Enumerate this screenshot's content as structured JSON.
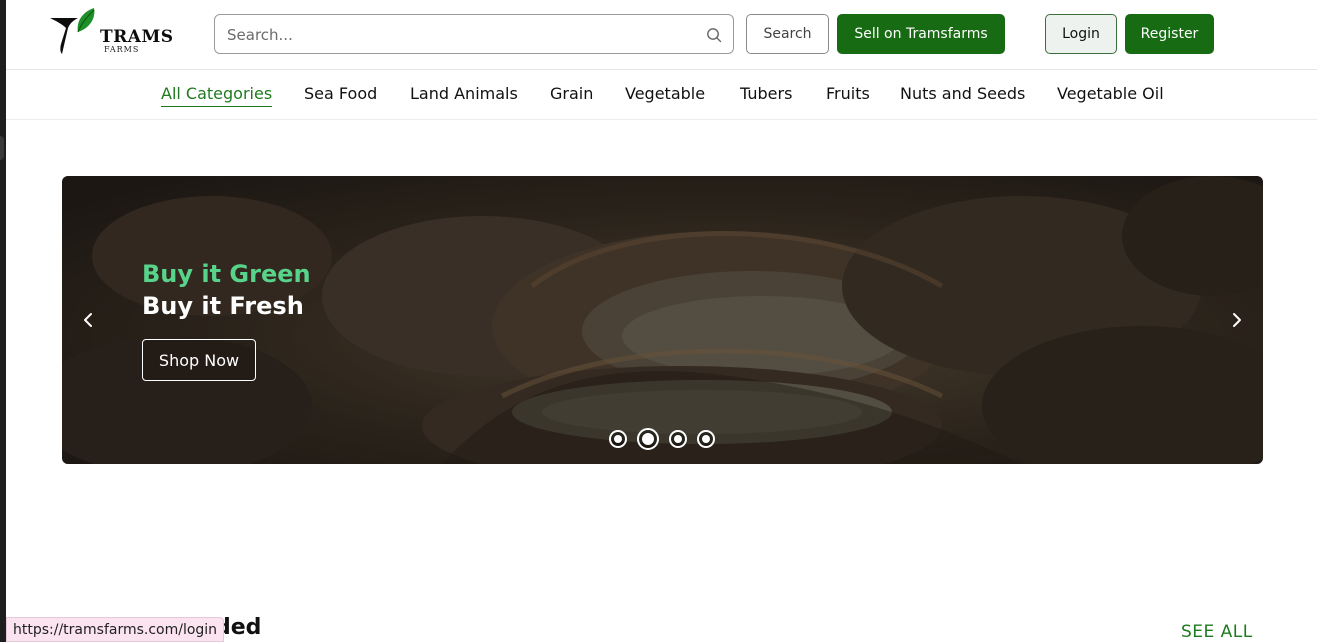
{
  "brand": {
    "name": "TRAMS",
    "sub": "FARMS",
    "green": "#176b12",
    "accent_text": "#1f7a1f",
    "headline_green": "#58d38a"
  },
  "header": {
    "search_placeholder": "Search...",
    "search_button": "Search",
    "sell_button": "Sell on Tramsfarms",
    "login_button": "Login",
    "register_button": "Register"
  },
  "categories": [
    {
      "label": "All Categories",
      "active": true
    },
    {
      "label": "Sea Food",
      "active": false
    },
    {
      "label": "Land Animals",
      "active": false
    },
    {
      "label": "Grain",
      "active": false
    },
    {
      "label": "Vegetable",
      "active": false
    },
    {
      "label": "Tubers",
      "active": false
    },
    {
      "label": "Fruits",
      "active": false
    },
    {
      "label": "Nuts and Seeds",
      "active": false
    },
    {
      "label": "Vegetable Oil",
      "active": false
    }
  ],
  "hero": {
    "line1": "Buy it Green",
    "line2": "Buy it Fresh",
    "cta": "Shop Now",
    "slide_count": 4,
    "active_slide": 2,
    "prev_icon": "chevron-left-icon",
    "next_icon": "chevron-right-icon"
  },
  "section": {
    "title_visible": "ded",
    "see_all": "SEE ALL"
  },
  "status_bar": {
    "url": "https://tramsfarms.com/login"
  }
}
